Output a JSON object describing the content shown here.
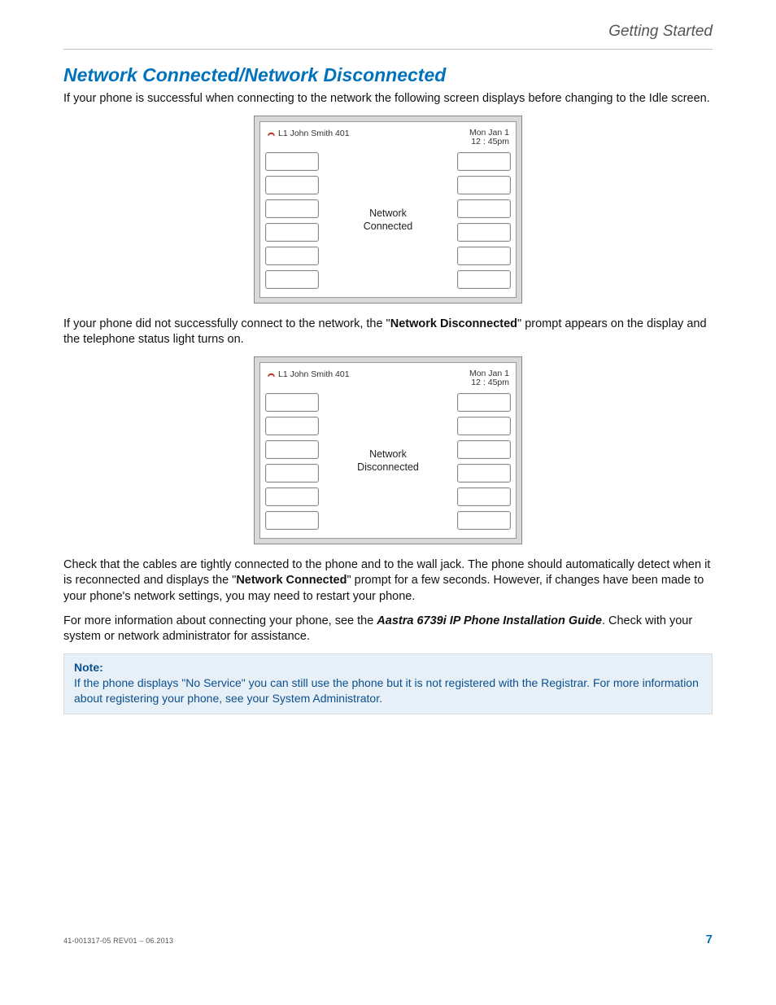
{
  "header": {
    "running": "Getting Started"
  },
  "title": "Network Connected/Network Disconnected",
  "para1": "If your phone is successful when connecting to the network the following screen displays before changing to the Idle screen.",
  "phone1": {
    "line": "L1 John Smith 401",
    "date": "Mon Jan 1",
    "time": "12 : 45pm",
    "status_l1": "Network",
    "status_l2": "Connected"
  },
  "para2_a": "If your phone did not successfully connect to the network, the \"",
  "para2_bold": "Network Disconnected",
  "para2_b": "\" prompt appears on the display and the telephone status light turns on.",
  "phone2": {
    "line": "L1 John Smith 401",
    "date": "Mon Jan 1",
    "time": "12 : 45pm",
    "status_l1": "Network",
    "status_l2": "Disconnected"
  },
  "para3_a": "Check that the cables are tightly connected to the phone and to the wall jack. The phone should automatically detect when it is reconnected and displays the \"",
  "para3_bold": "Network Connected",
  "para3_b": "\" prompt for a few seconds. However, if changes have been made to your phone's network settings, you may need to restart your phone.",
  "para4_a": "For more information about connecting your phone, see the ",
  "para4_bold_italic": "Aastra 6739i IP Phone Installation Guide",
  "para4_b": ". Check with your system or network administrator for assistance.",
  "note": {
    "label": "Note:",
    "text": "If the phone displays \"No Service\" you can still use the phone but it is not registered with the Registrar. For more information about registering your phone, see your System Administrator."
  },
  "footer": {
    "left": "41-001317-05 REV01 – 06.2013",
    "page": "7"
  }
}
